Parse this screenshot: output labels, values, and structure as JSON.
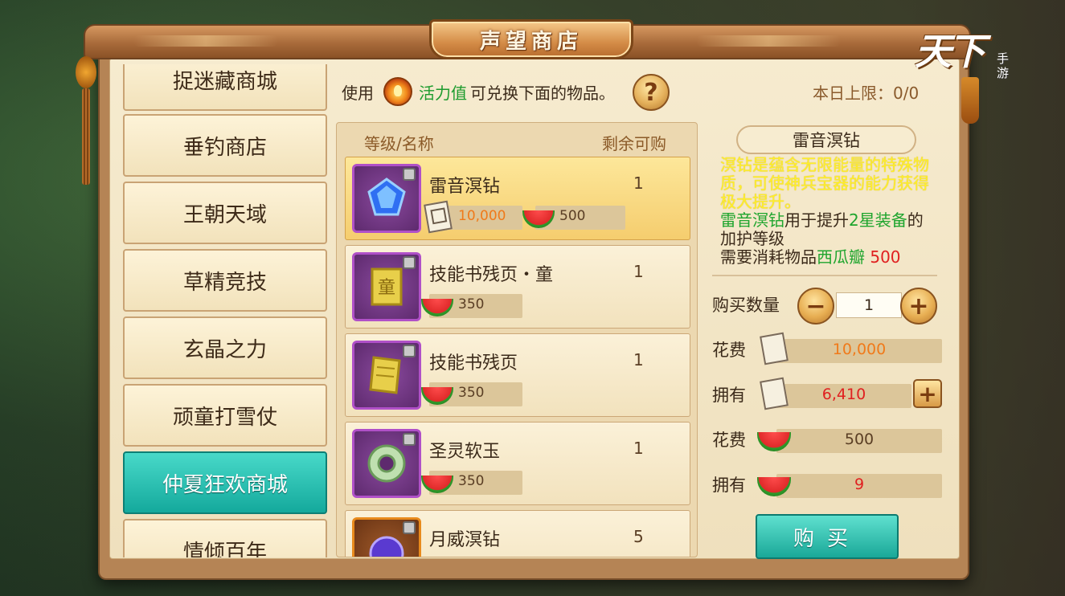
{
  "title": "声望商店",
  "logo": {
    "main": "天下",
    "sub": "手游"
  },
  "menu": [
    {
      "label": "捉迷藏商城"
    },
    {
      "label": "垂钓商店"
    },
    {
      "label": "王朝天域"
    },
    {
      "label": "草精竞技"
    },
    {
      "label": "玄晶之力"
    },
    {
      "label": "顽童打雪仗"
    },
    {
      "label": "仲夏狂欢商城",
      "active": true
    },
    {
      "label": "情倾百年"
    }
  ],
  "info": {
    "use": "使用",
    "vitality": "活力值",
    "rest": "可兑换下面的物品。",
    "help": "?",
    "daily_limit": "本日上限：0/0"
  },
  "list": {
    "col_name": "等级/名称",
    "col_remain": "剩余可购",
    "items": [
      {
        "name": "雷音溟钻",
        "remain": "1",
        "price_note": "10,000",
        "price_melon": "500",
        "icon": "blue-crystal-icon",
        "selected": true
      },
      {
        "name": "技能书残页・童",
        "remain": "1",
        "price_melon": "350",
        "icon": "skill-page-tong-icon"
      },
      {
        "name": "技能书残页",
        "remain": "1",
        "price_melon": "350",
        "icon": "skill-page-icon"
      },
      {
        "name": "圣灵软玉",
        "remain": "1",
        "price_melon": "350",
        "icon": "jade-ring-icon"
      },
      {
        "name": "月威溟钻",
        "remain": "5",
        "icon": "purple-crystal-icon"
      }
    ]
  },
  "detail": {
    "name": "雷音溟钻",
    "desc_yellow": "溟钻是蕴含无限能量的特殊物质，可使神兵宝器的能力获得极大提升。",
    "desc_g1": "雷音溟钻",
    "desc_b1": "用于提升",
    "desc_g2": "2星装备",
    "desc_b2": "的加护等级",
    "desc_b3": "需要消耗物品",
    "desc_g3": "西瓜瓣",
    "desc_r3": "500",
    "qty_label": "购买数量",
    "qty_value": "1",
    "minus": "−",
    "plus": "+",
    "cost_label": "花费",
    "own_label": "拥有",
    "cost_note": "10,000",
    "own_note": "6,410",
    "cost_melon": "500",
    "own_melon": "9",
    "buy": "购买"
  },
  "colors": {
    "accent_teal": "#1aa898",
    "price_orange": "#f07a1a",
    "own_red": "#e02020",
    "vitality_green": "#1d9b2d"
  }
}
